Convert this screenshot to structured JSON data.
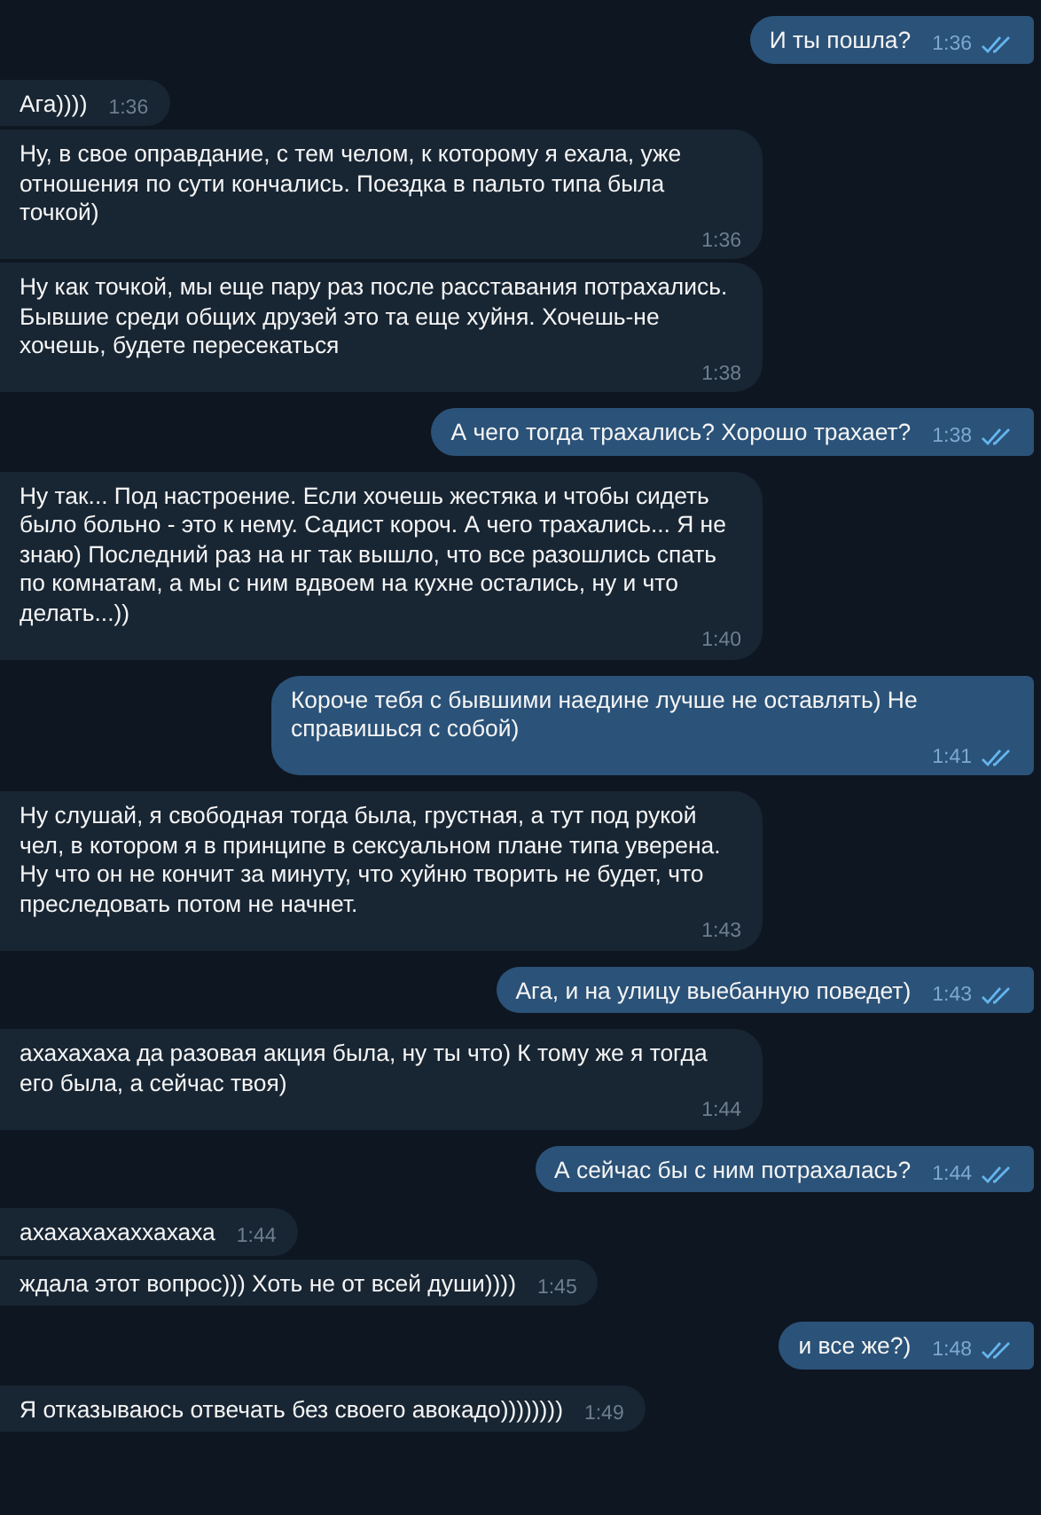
{
  "messages": [
    {
      "kind": "outgoing",
      "text": "И ты пошла?",
      "time": "1:36",
      "read": true
    },
    {
      "kind": "incoming",
      "text": "Ага))))",
      "time": "1:36"
    },
    {
      "kind": "incoming",
      "text": "Ну, в свое оправдание, с тем челом, к которому я ехала, уже отношения по сути кончались. Поездка в пальто типа была точкой)",
      "time": "1:36"
    },
    {
      "kind": "incoming",
      "text": "Ну как точкой, мы еще пару раз после расставания потрахались. Бывшие среди общих друзей это та еще хуйня. Хочешь-не хочешь, будете пересекаться",
      "time": "1:38"
    },
    {
      "kind": "outgoing",
      "text": "А чего тогда трахались? Хорошо трахает?",
      "time": "1:38",
      "read": true
    },
    {
      "kind": "incoming",
      "text": "Ну так... Под настроение. Если хочешь жестяка и чтобы сидеть было больно - это к нему. Садист короч. А чего трахались... Я не знаю) Последний раз на нг так вышло, что все разошлись спать по комнатам, а мы с ним вдвоем на кухне остались, ну и что делать...))",
      "time": "1:40"
    },
    {
      "kind": "outgoing",
      "text": "Короче тебя с бывшими наедине лучше не оставлять) Не справишься с собой)",
      "time": "1:41",
      "read": true
    },
    {
      "kind": "incoming",
      "text": "Ну слушай, я свободная тогда была, грустная, а тут под рукой чел, в котором я в принципе в сексуальном плане типа уверена. Ну что он не кончит за минуту, что хуйню творить не будет, что преследовать потом не начнет.",
      "time": "1:43"
    },
    {
      "kind": "outgoing",
      "text": "Ага, и на улицу выебанную поведет)",
      "time": "1:43",
      "read": true
    },
    {
      "kind": "incoming",
      "text": "ахахахаха да разовая акция была, ну ты что) К тому же я тогда его была, а сейчас твоя)",
      "time": "1:44"
    },
    {
      "kind": "outgoing",
      "text": "А сейчас бы с ним потрахалась?",
      "time": "1:44",
      "read": true
    },
    {
      "kind": "incoming",
      "text": "ахахахахаххахаха",
      "time": "1:44"
    },
    {
      "kind": "incoming",
      "text": "ждала этот вопрос))) Хоть не от всей души))))",
      "time": "1:45"
    },
    {
      "kind": "outgoing",
      "text": "и все же?)",
      "time": "1:48",
      "read": true
    },
    {
      "kind": "incoming",
      "text": "Я отказываюсь отвечать без своего авокадо))))))))",
      "time": "1:49"
    }
  ]
}
